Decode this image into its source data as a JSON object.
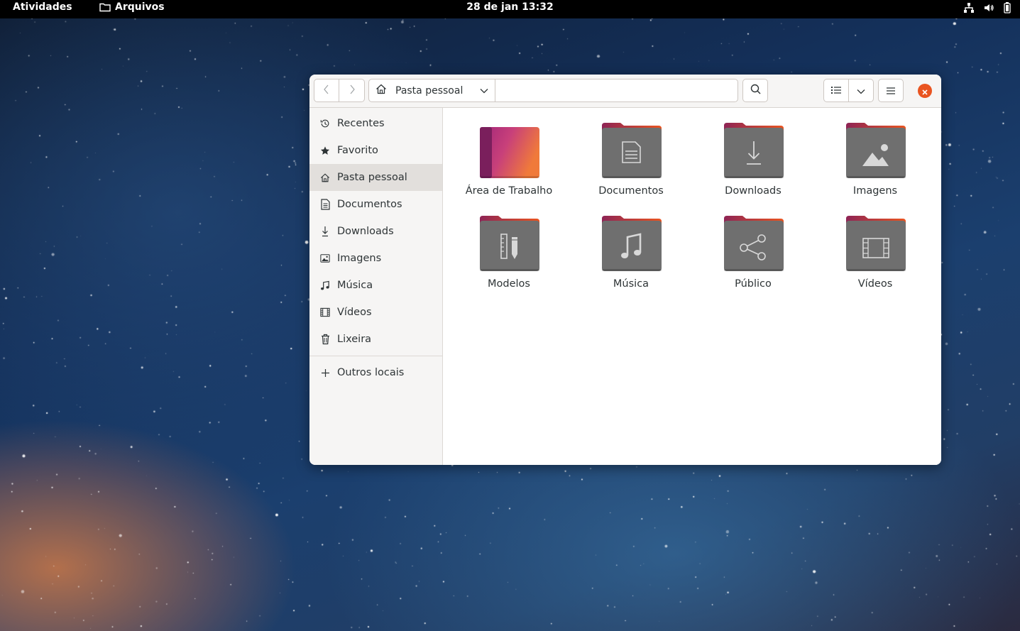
{
  "topbar": {
    "activities": "Atividades",
    "app_name": "Arquivos",
    "clock": "28 de jan  13:32"
  },
  "window": {
    "path_label": "Pasta pessoal",
    "accent_color": "#e95420"
  },
  "sidebar": {
    "items": [
      {
        "label": "Recentes",
        "icon": "clock-icon"
      },
      {
        "label": "Favorito",
        "icon": "star-icon"
      },
      {
        "label": "Pasta pessoal",
        "icon": "home-icon",
        "active": true
      },
      {
        "label": "Documentos",
        "icon": "document-icon"
      },
      {
        "label": "Downloads",
        "icon": "download-icon"
      },
      {
        "label": "Imagens",
        "icon": "image-icon"
      },
      {
        "label": "Música",
        "icon": "music-icon"
      },
      {
        "label": "Vídeos",
        "icon": "video-icon"
      },
      {
        "label": "Lixeira",
        "icon": "trash-icon"
      }
    ],
    "other_locations": "Outros locais"
  },
  "files": [
    {
      "label": "Área de Trabalho",
      "icon": "desktop-folder-icon"
    },
    {
      "label": "Documentos",
      "icon": "documents-folder-icon"
    },
    {
      "label": "Downloads",
      "icon": "downloads-folder-icon"
    },
    {
      "label": "Imagens",
      "icon": "pictures-folder-icon"
    },
    {
      "label": "Modelos",
      "icon": "templates-folder-icon"
    },
    {
      "label": "Música",
      "icon": "music-folder-icon"
    },
    {
      "label": "Público",
      "icon": "public-folder-icon"
    },
    {
      "label": "Vídeos",
      "icon": "videos-folder-icon"
    }
  ]
}
